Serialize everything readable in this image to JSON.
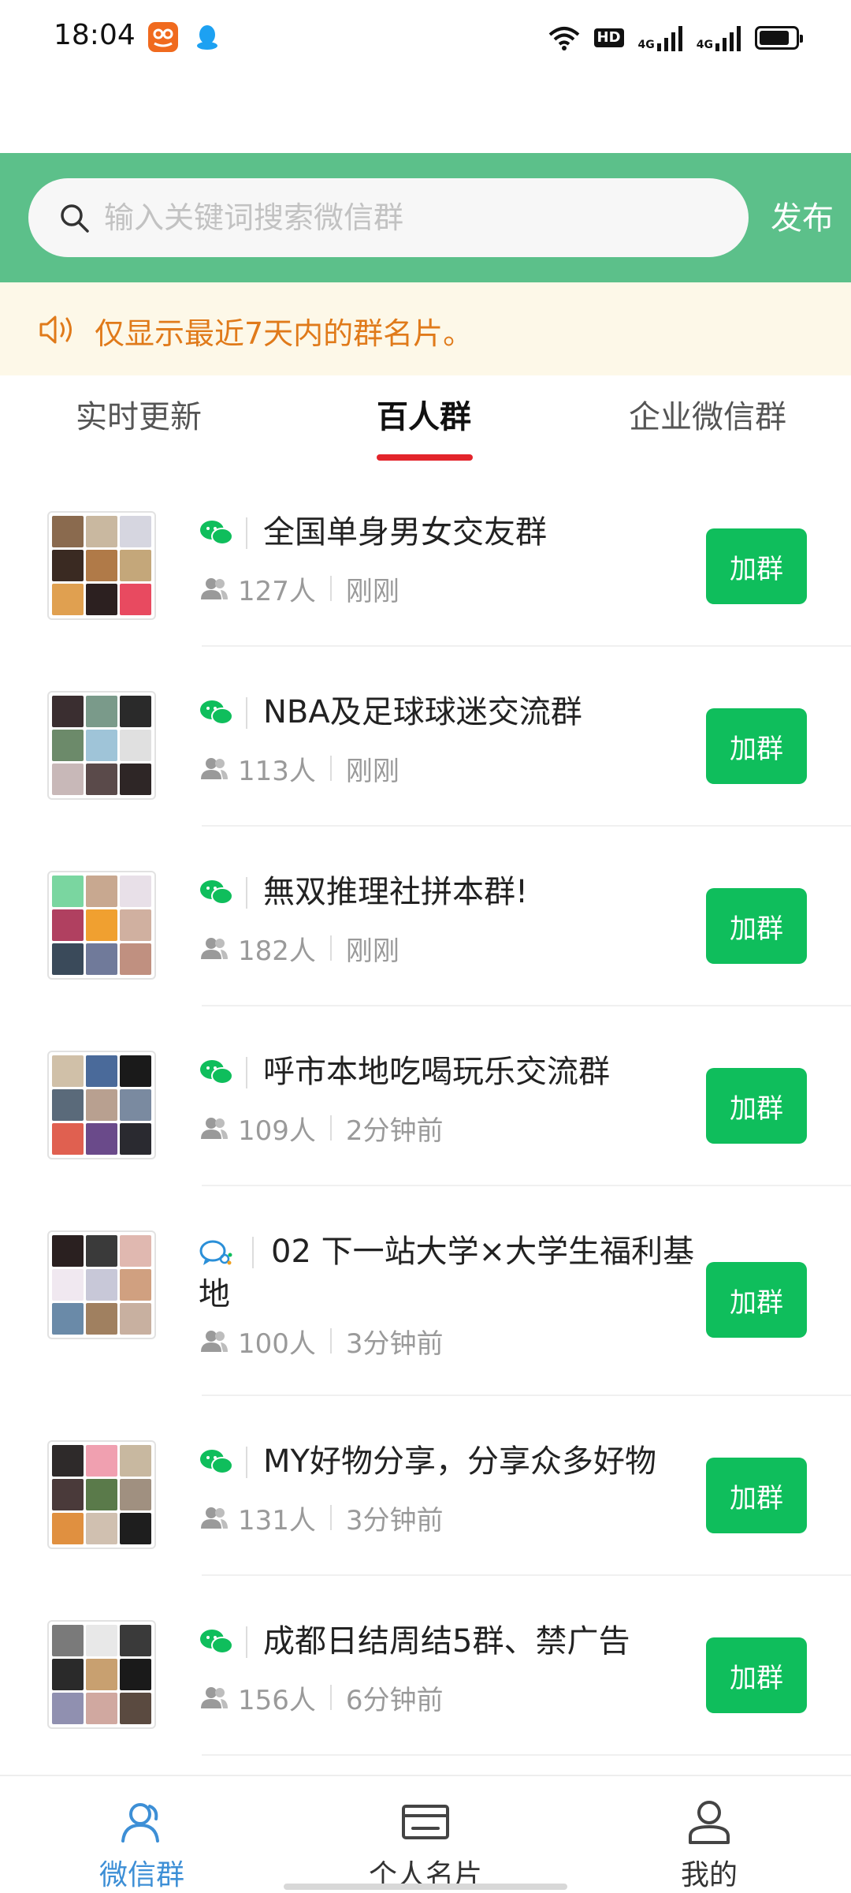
{
  "status_bar": {
    "time": "18:04",
    "left_icons": [
      "taobao-app-icon",
      "qq-app-icon"
    ],
    "right_icons": [
      "wifi-icon",
      "hd-icon",
      "signal-4g-icon",
      "signal-4g-icon",
      "battery-icon"
    ],
    "hd_label": "HD",
    "network_label": "4G"
  },
  "header": {
    "search_placeholder": "输入关键词搜索微信群",
    "publish_label": "发布",
    "background_color": "#5cc08a"
  },
  "notice": {
    "text": "仅显示最近7天内的群名片。",
    "icon": "speaker-icon",
    "text_color": "#e07a1a"
  },
  "tabs": [
    {
      "label": "实时更新",
      "active": false
    },
    {
      "label": "百人群",
      "active": true
    },
    {
      "label": "企业微信群",
      "active": false
    }
  ],
  "groups": [
    {
      "title": "全国单身男女交友群",
      "count": "127人",
      "time": "刚刚",
      "icon": "wechat-icon",
      "join_label": "加群"
    },
    {
      "title": "NBA及足球球迷交流群",
      "count": "113人",
      "time": "刚刚",
      "icon": "wechat-icon",
      "join_label": "加群"
    },
    {
      "title": "無双推理社拼本群!",
      "count": "182人",
      "time": "刚刚",
      "icon": "wechat-icon",
      "join_label": "加群"
    },
    {
      "title": "呼市本地吃喝玩乐交流群",
      "count": "109人",
      "time": "2分钟前",
      "icon": "wechat-icon",
      "join_label": "加群"
    },
    {
      "title": "02 下一站大学×大学生福利基地",
      "count": "100人",
      "time": "3分钟前",
      "icon": "wecom-icon",
      "join_label": "加群"
    },
    {
      "title": "MY好物分享，分享众多好物",
      "count": "131人",
      "time": "3分钟前",
      "icon": "wechat-icon",
      "join_label": "加群"
    },
    {
      "title": "成都日结周结5群、禁广告",
      "count": "156人",
      "time": "6分钟前",
      "icon": "wechat-icon",
      "join_label": "加群"
    }
  ],
  "bottom_nav": [
    {
      "label": "微信群",
      "icon": "group-icon",
      "active": true
    },
    {
      "label": "个人名片",
      "icon": "card-icon",
      "active": false
    },
    {
      "label": "我的",
      "icon": "profile-icon",
      "active": false
    }
  ],
  "colors": {
    "accent_green": "#0fbe5c",
    "tab_indicator": "#e3242b",
    "nav_active": "#3d8fd6"
  }
}
